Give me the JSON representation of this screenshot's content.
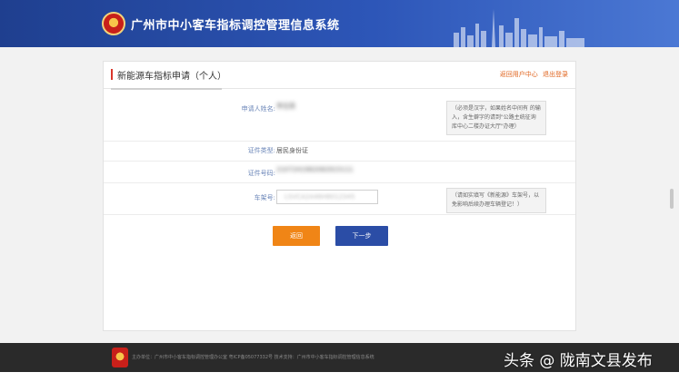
{
  "header": {
    "title": "广州市中小客车指标调控管理信息系统"
  },
  "card": {
    "title": "新能源车指标申请（个人）",
    "link_user_center": "返回用户中心",
    "link_logout": "退出登录"
  },
  "form": {
    "name": {
      "label": "申请人姓名:",
      "value": "李志英"
    },
    "name_note": "（必须是汉字，如果姓名中间有 的输入，含生僻字的请到\"公路主统征询库中心二楼办证大厅\"办理）",
    "id_type": {
      "label": "证件类型:",
      "value": "居民身份证"
    },
    "id_number": {
      "label": "证件号码:",
      "value": "2107241982082915111"
    },
    "plate": {
      "label": "车架号:",
      "value": "LSVCA2A46H8012345"
    },
    "plate_note": "（请如实填写《新能源》车架号，以免影响后续办理车辆登记！）"
  },
  "buttons": {
    "back": "返回",
    "next": "下一步"
  },
  "footer": {
    "text": "主办单位：广州市中小客车指标调控管理办公室   粤ICP备05077332号   技术支持：广州市中小客车指标调控管理信息系统"
  },
  "watermark": "头条 @ 陇南文县发布",
  "colors": {
    "header_start": "#1f3f8f",
    "header_end": "#4b78d4",
    "accent_red": "#d9362b",
    "orange": "#f08516",
    "blue_button": "#2b4da6",
    "footer_bg": "#2a2a2a"
  }
}
